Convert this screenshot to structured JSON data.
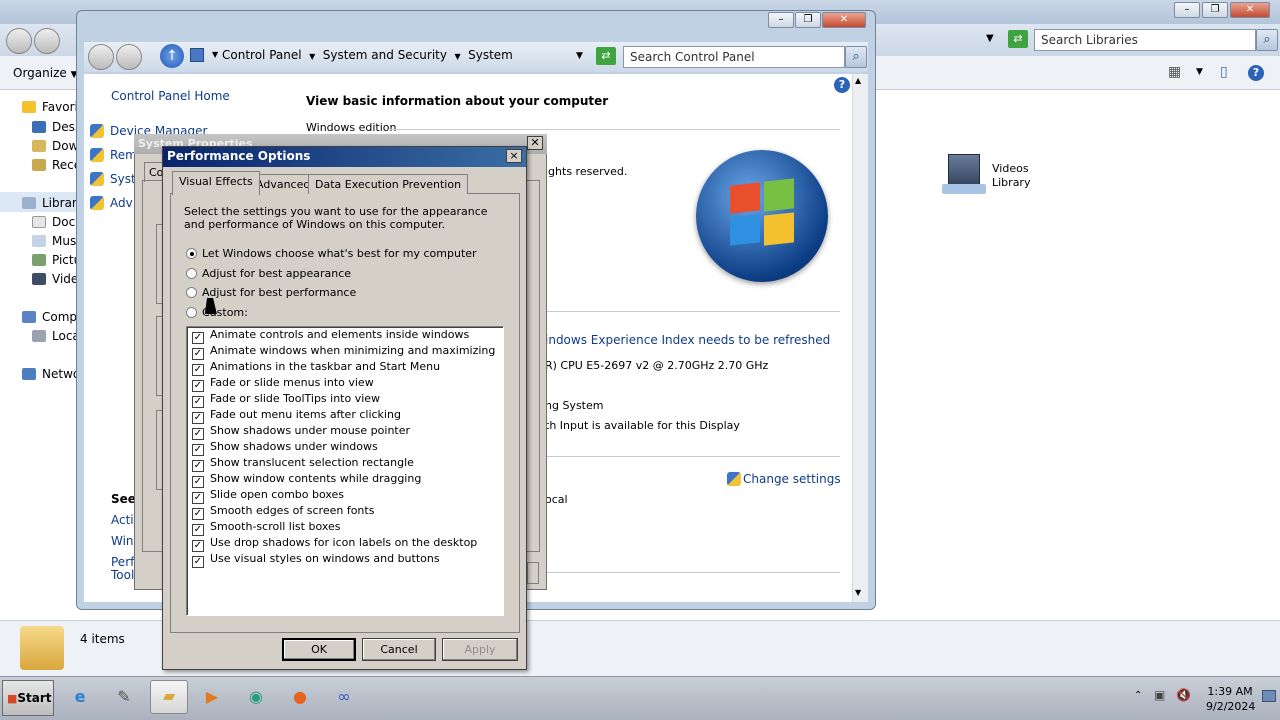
{
  "libraries_window": {
    "search_placeholder": "Search Libraries",
    "toolbar": {
      "organize_label": "Organize"
    },
    "nav": [
      {
        "label": "Favorites",
        "icon": "star-icon"
      },
      {
        "label": "Deskto",
        "icon": "desktop-icon"
      },
      {
        "label": "Downlo",
        "icon": "downloads-icon"
      },
      {
        "label": "Recen",
        "icon": "recent-places-icon"
      },
      {
        "label": "Libraries",
        "icon": "libraries-icon"
      },
      {
        "label": "Docum",
        "icon": "documents-icon"
      },
      {
        "label": "Music",
        "icon": "music-icon"
      },
      {
        "label": "Picture",
        "icon": "pictures-icon"
      },
      {
        "label": "Videos",
        "icon": "videos-icon"
      },
      {
        "label": "Compute",
        "icon": "computer-icon"
      },
      {
        "label": "Local D",
        "icon": "drive-icon"
      },
      {
        "label": "Network",
        "icon": "network-icon"
      }
    ],
    "videos_library": {
      "line1": "Videos",
      "line2": "Library"
    },
    "details": {
      "items_count": "4 items"
    }
  },
  "control_panel": {
    "breadcrumb": [
      "Control Panel",
      "System and Security",
      "System"
    ],
    "search_placeholder": "Search Control Panel",
    "sidebar": {
      "home_link": "Control Panel Home",
      "links": [
        "Device Manager",
        "Rem",
        "Syst",
        "Adv"
      ],
      "see_also_heading": "See",
      "see_also": [
        "Actio",
        "Windo",
        "Perf",
        "Tool"
      ]
    },
    "main": {
      "heading": "View basic information about your computer",
      "section_windows_edition": "Windows edition",
      "rights_text": "ights reserved.",
      "wei_link": "indows Experience Index needs to be refreshed",
      "cpu_text": "R) CPU E5-2697 v2 @ 2.70GHz   2.70 GHz",
      "os_type": "ng System",
      "pen_touch": "th Input is available for this Display",
      "change_settings": "Change settings",
      "workgroup": "ocal"
    }
  },
  "system_properties": {
    "title": "System Properties",
    "tab_partial": "Co"
  },
  "performance_options": {
    "title": "Performance Options",
    "close_label": "×",
    "tabs": [
      "Visual Effects",
      "Advanced",
      "Data Execution Prevention"
    ],
    "description": "Select the settings you want to use for the appearance and performance of Windows on this computer.",
    "radios": [
      {
        "label": "Let Windows choose what's best for my computer",
        "selected": true
      },
      {
        "label": "Adjust for best appearance",
        "selected": false
      },
      {
        "label": "Adjust for best performance",
        "selected": false
      },
      {
        "label": "Custom:",
        "selected": false
      }
    ],
    "effects": [
      "Animate controls and elements inside windows",
      "Animate windows when minimizing and maximizing",
      "Animations in the taskbar and Start Menu",
      "Fade or slide menus into view",
      "Fade or slide ToolTips into view",
      "Fade out menu items after clicking",
      "Show shadows under mouse pointer",
      "Show shadows under windows",
      "Show translucent selection rectangle",
      "Show window contents while dragging",
      "Slide open combo boxes",
      "Smooth edges of screen fonts",
      "Smooth-scroll list boxes",
      "Use drop shadows for icon labels on the desktop",
      "Use visual styles on windows and buttons"
    ],
    "buttons": {
      "ok": "OK",
      "cancel": "Cancel",
      "apply": "Apply"
    }
  },
  "taskbar": {
    "start_label": "Start",
    "clock_time": "1:39 AM",
    "clock_date": "9/2/2024"
  }
}
